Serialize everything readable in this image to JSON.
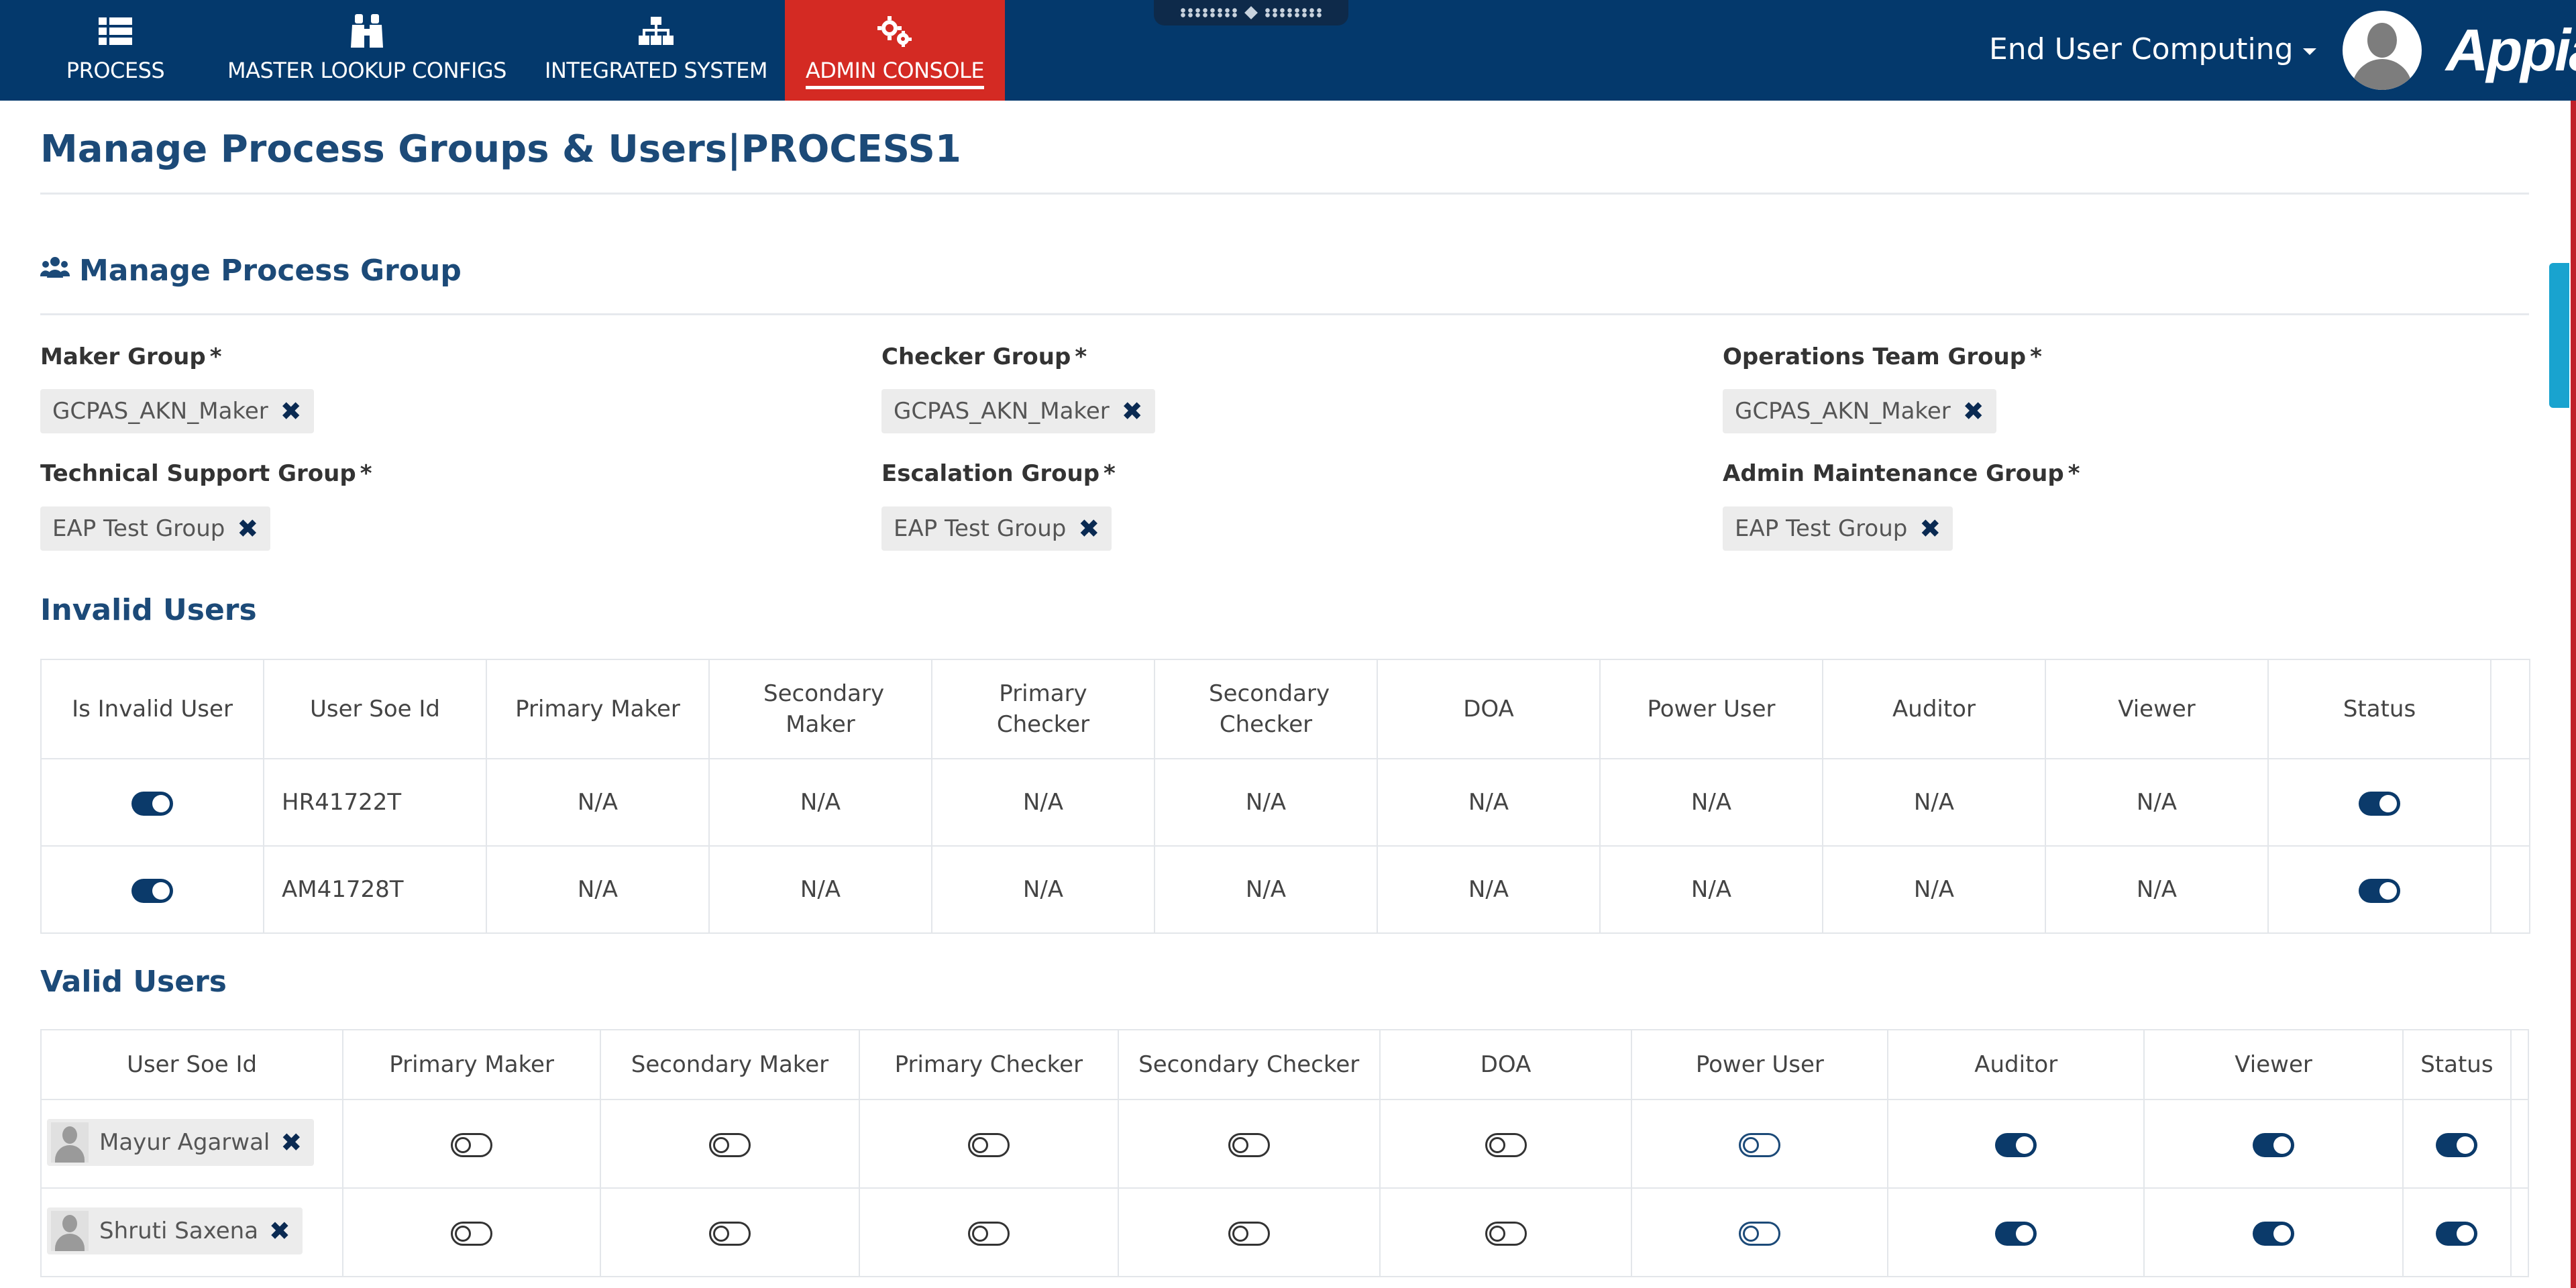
{
  "nav": {
    "items": [
      {
        "label": "PROCESS",
        "icon": "list-icon"
      },
      {
        "label": "MASTER LOOKUP CONFIGS",
        "icon": "binoculars-icon"
      },
      {
        "label": "INTEGRATED SYSTEM",
        "icon": "sitemap-icon"
      },
      {
        "label": "ADMIN CONSOLE",
        "icon": "gears-icon"
      }
    ],
    "active": "ADMIN CONSOLE",
    "user_menu": "End User Computing",
    "logo": "Appian"
  },
  "page": {
    "title": "Manage Process Groups & Users|PROCESS1"
  },
  "groups": {
    "section_title": "Manage Process Group",
    "fields": [
      {
        "label": "Maker Group",
        "value": "GCPAS_AKN_Maker"
      },
      {
        "label": "Checker Group",
        "value": "GCPAS_AKN_Maker"
      },
      {
        "label": "Operations Team Group",
        "value": "GCPAS_AKN_Maker"
      },
      {
        "label": "Technical Support Group",
        "value": "EAP Test Group"
      },
      {
        "label": "Escalation Group",
        "value": "EAP Test Group"
      },
      {
        "label": "Admin Maintenance Group",
        "value": "EAP Test Group"
      }
    ],
    "required_mark": "*"
  },
  "invalid_users": {
    "title": "Invalid Users",
    "columns": [
      "Is Invalid User",
      "User Soe Id",
      "Primary Maker",
      "Secondary Maker",
      "Primary Checker",
      "Secondary Checker",
      "DOA",
      "Power User",
      "Auditor",
      "Viewer",
      "Status"
    ],
    "rows": [
      {
        "is_invalid": true,
        "soe_id": "HR41722T",
        "primary_maker": "N/A",
        "secondary_maker": "N/A",
        "primary_checker": "N/A",
        "secondary_checker": "N/A",
        "doa": "N/A",
        "power_user": "N/A",
        "auditor": "N/A",
        "viewer": "N/A",
        "status": true
      },
      {
        "is_invalid": true,
        "soe_id": "AM41728T",
        "primary_maker": "N/A",
        "secondary_maker": "N/A",
        "primary_checker": "N/A",
        "secondary_checker": "N/A",
        "doa": "N/A",
        "power_user": "N/A",
        "auditor": "N/A",
        "viewer": "N/A",
        "status": true
      }
    ]
  },
  "valid_users": {
    "title": "Valid Users",
    "columns": [
      "User Soe Id",
      "Primary Maker",
      "Secondary Maker",
      "Primary Checker",
      "Secondary Checker",
      "DOA",
      "Power User",
      "Auditor",
      "Viewer",
      "Status"
    ],
    "rows": [
      {
        "name": "Mayur Agarwal",
        "primary_maker": false,
        "secondary_maker": false,
        "primary_checker": false,
        "secondary_checker": false,
        "doa": false,
        "power_user": false,
        "auditor": true,
        "viewer": true,
        "status": true
      },
      {
        "name": "Shruti Saxena",
        "primary_maker": false,
        "secondary_maker": false,
        "primary_checker": false,
        "secondary_checker": false,
        "doa": false,
        "power_user": false,
        "auditor": true,
        "viewer": true,
        "status": true
      }
    ]
  }
}
